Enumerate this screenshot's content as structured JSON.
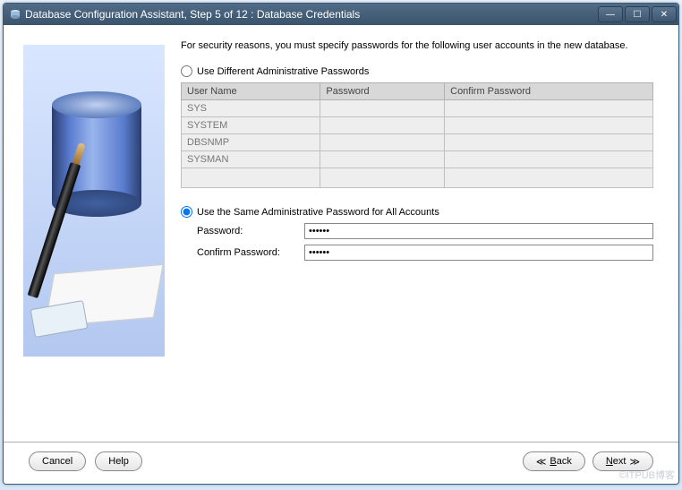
{
  "titlebar": {
    "title": "Database Configuration Assistant, Step 5 of 12 : Database Credentials"
  },
  "intro": "For security reasons, you must specify passwords for the following user accounts in the new database.",
  "options": {
    "different": {
      "label": "Use Different Administrative Passwords",
      "selected": false
    },
    "same": {
      "label": "Use the Same Administrative Password for All Accounts",
      "selected": true
    }
  },
  "table": {
    "headers": [
      "User Name",
      "Password",
      "Confirm Password"
    ],
    "rows": [
      {
        "user": "SYS",
        "password": "",
        "confirm": ""
      },
      {
        "user": "SYSTEM",
        "password": "",
        "confirm": ""
      },
      {
        "user": "DBSNMP",
        "password": "",
        "confirm": ""
      },
      {
        "user": "SYSMAN",
        "password": "",
        "confirm": ""
      }
    ]
  },
  "fields": {
    "password_label": "Password:",
    "confirm_label": "Confirm Password:",
    "password_value": "******",
    "confirm_value": "******"
  },
  "buttons": {
    "cancel": "Cancel",
    "help": "Help",
    "back": "Back",
    "next": "Next"
  },
  "watermark": "©ITPUB博客"
}
